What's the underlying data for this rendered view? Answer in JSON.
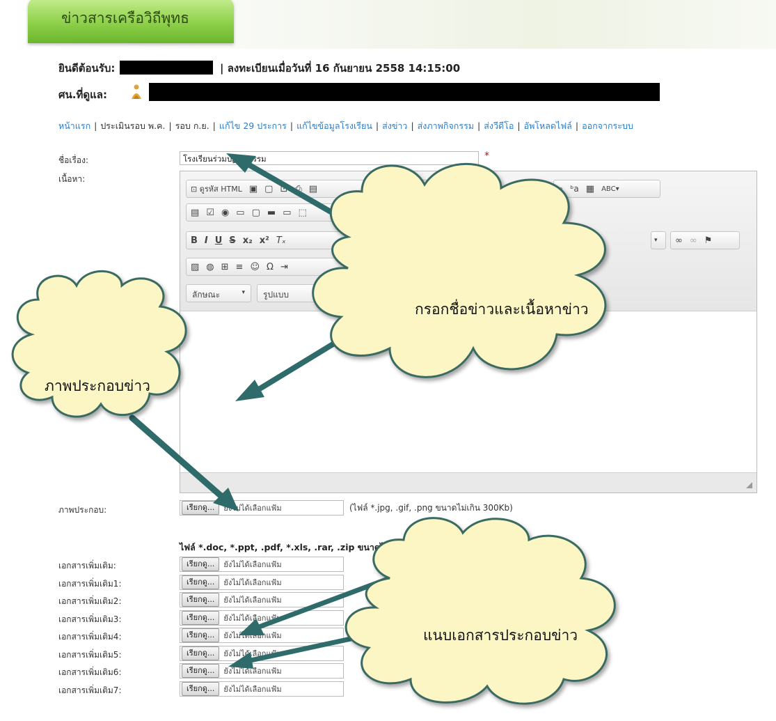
{
  "header": {
    "tab_title": "ข่าวสารเครือวิถีพุทธ",
    "welcome_label": "ยินดีต้อนรับ:",
    "registered_text": "| ลงทะเบียนเมื่อวันที่ 16 กันยายน 2558 14:15:00",
    "teacher_label": "ศน.ที่ดูแล:"
  },
  "nav": {
    "items": [
      "หน้าแรก",
      "ประเมินรอบ พ.ค.",
      "รอบ ก.ย.",
      "แก้ไข 29 ประการ",
      "แก้ไขข้อมูลโรงเรียน",
      "ส่งข่าว",
      "ส่งภาพกิจกรรม",
      "ส่งวีดีโอ",
      "อัพโหลดไฟล์",
      "ออกจากระบบ"
    ]
  },
  "form": {
    "title_label": "ชื่อเรื่อง:",
    "title_value": "โรงเรียนร่วมปฏิบัติธรรม",
    "required_mark": "*",
    "content_label": "เนื้อหา:",
    "image_label": "ภาพประกอบ:",
    "image_hint": "(ไฟล์ *.jpg, .gif, .png ขนาดไม่เกิน 300Kb)",
    "file_types": "ไฟล์ *.doc, *.ppt, .pdf, *.xls, .rar, .zip ขนาดไม่เกิน 50",
    "browse_label": "เรียกดู...",
    "no_file_text": "ยังไม่ได้เลือกแฟ้ม",
    "attachments": [
      "เอกสารเพิ่มเติม:",
      "เอกสารเพิ่มเติม1:",
      "เอกสารเพิ่มเติม2:",
      "เอกสารเพิ่มเติม3:",
      "เอกสารเพิ่มเติม4:",
      "เอกสารเพิ่มเติม5:",
      "เอกสารเพิ่มเติม6:",
      "เอกสารเพิ่มเติม7:"
    ]
  },
  "editor": {
    "source_label": "ดูรหัส HTML",
    "style_combo": "ลักษณะ",
    "format_combo": "รูปแบบ"
  },
  "callouts": {
    "fill_news": "กรอกชื่อข่าวและเนื้อหาข่าว",
    "news_image": "ภาพประกอบข่าว",
    "attach_docs": "แนบเอกสารประกอบข่าว"
  },
  "colors": {
    "tab_green": "#8fd14b",
    "link_blue": "#2e7cc6",
    "cloud_fill": "#fbf6c4",
    "arrow_teal": "#2f6b6a"
  }
}
